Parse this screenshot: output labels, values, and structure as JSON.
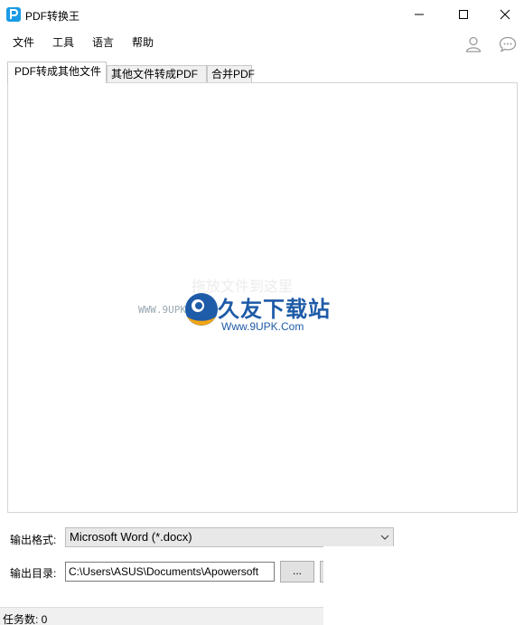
{
  "window": {
    "title": "PDF转换王",
    "accent_color": "#1a9be6"
  },
  "menu": [
    {
      "label": "文件"
    },
    {
      "label": "工具"
    },
    {
      "label": "语言"
    },
    {
      "label": "帮助"
    }
  ],
  "header_icons": [
    "user-icon",
    "chat-icon"
  ],
  "tabs": [
    {
      "label": "PDF转成其他文件",
      "active": true
    },
    {
      "label": "其他文件转成PDF",
      "active": false
    },
    {
      "label": "合并PDF",
      "active": false
    }
  ],
  "dropzone": {
    "text": "拖放文件到这里"
  },
  "watermark": {
    "small_text": "WWW.9UPK.COM",
    "brand": "久友下载站",
    "url": "Www.9UPK.Com"
  },
  "output": {
    "format_label": "输出格式:",
    "format_value": "Microsoft Word (*.docx)",
    "dir_label": "输出目录:",
    "dir_value": "C:\\Users\\ASUS\\Documents\\Apowersoft",
    "browse_label": "..."
  },
  "status": {
    "text": "任务数: 0"
  }
}
